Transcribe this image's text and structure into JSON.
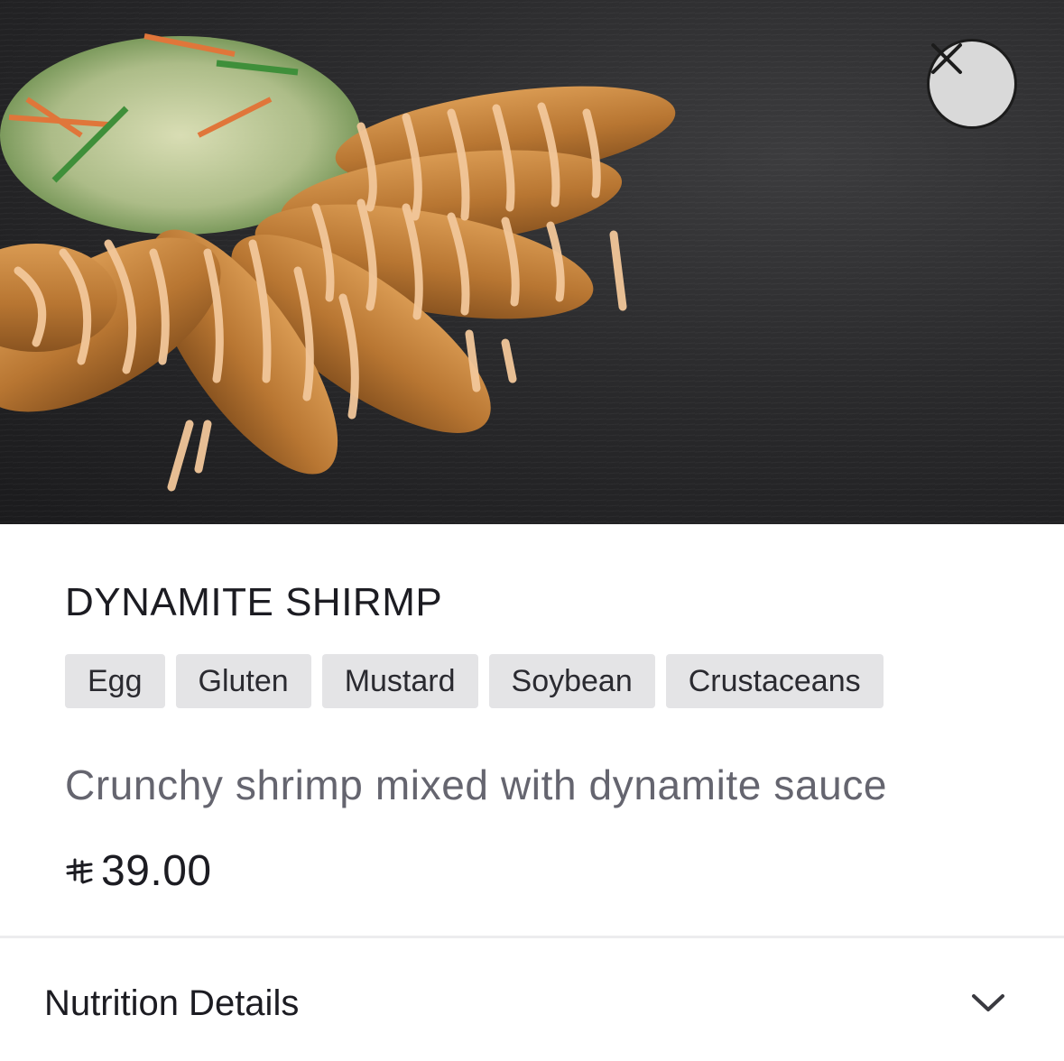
{
  "product": {
    "name": "DYNAMITE SHIRMP",
    "allergens": [
      "Egg",
      "Gluten",
      "Mustard",
      "Soybean",
      "Crustaceans"
    ],
    "description": "Crunchy shrimp mixed with dynamite sauce",
    "price": "39.00",
    "currency_icon": "riyal-icon"
  },
  "hero": {
    "image": "dynamite-shrimp-photo"
  },
  "close_icon": "close-icon",
  "nutrition": {
    "label": "Nutrition Details",
    "icon": "chevron-down-icon"
  },
  "colors": {
    "tag_bg": "#e4e4e6",
    "description": "#65656f",
    "close_bg": "#d9d9d9"
  }
}
